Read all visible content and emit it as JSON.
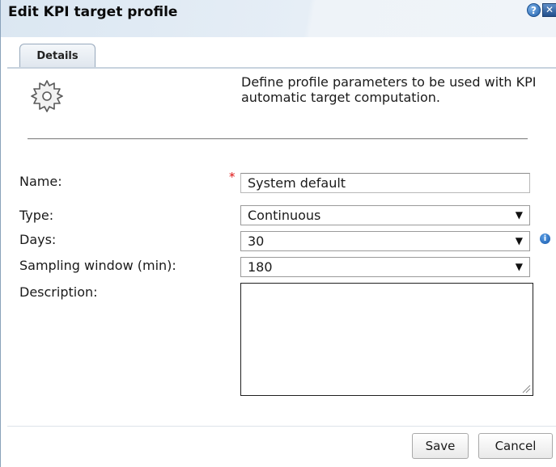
{
  "dialog": {
    "title": "Edit KPI target profile",
    "help_glyph": "?",
    "close_glyph": "✕"
  },
  "tabs": [
    {
      "label": "Details",
      "active": true
    }
  ],
  "intro": {
    "icon": "gear-icon",
    "text": "Define profile parameters to be used with KPI automatic target computation."
  },
  "form": {
    "name": {
      "label": "Name:",
      "value": "System default",
      "required_mark": "*"
    },
    "type": {
      "label": "Type:",
      "value": "Continuous"
    },
    "days": {
      "label": "Days:",
      "value": "30",
      "info_icon": "info-icon",
      "info_glyph": "i"
    },
    "sampling": {
      "label": "Sampling window (min):",
      "value": "180"
    },
    "description": {
      "label": "Description:",
      "value": ""
    }
  },
  "dropdown_arrow": "▼",
  "buttons": {
    "save": "Save",
    "cancel": "Cancel"
  },
  "colors": {
    "title_bar": "#dbe7f2",
    "required": "#dd1111",
    "accent": "#1f5faa"
  }
}
